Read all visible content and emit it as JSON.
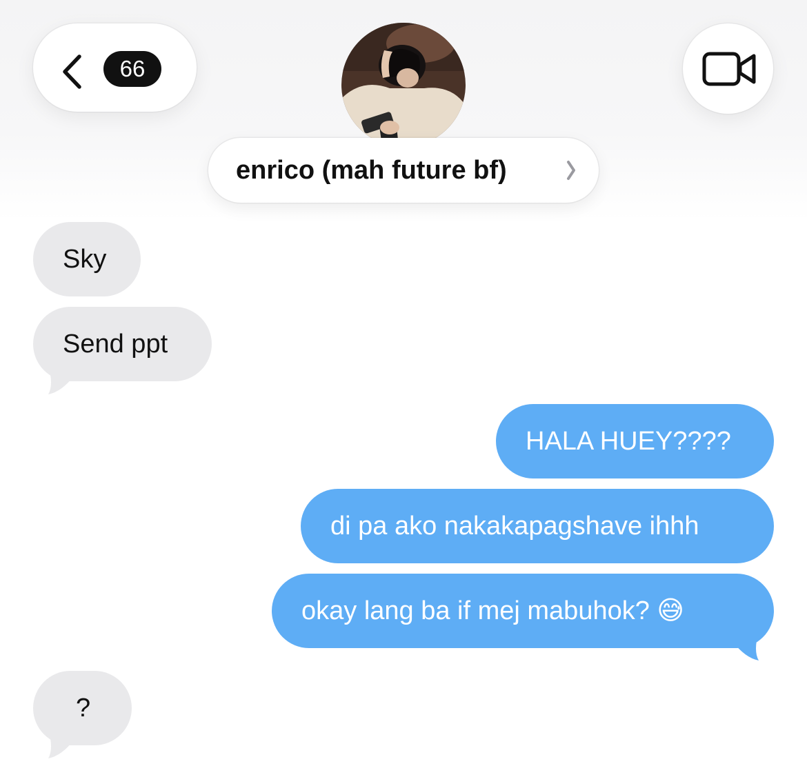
{
  "header": {
    "unread_count": "66",
    "contact_name": "enrico (mah future bf)",
    "icons": {
      "back": "chevron-left-icon",
      "video": "video-camera-icon",
      "name_chevron": "chevron-right-icon"
    }
  },
  "messages": [
    {
      "direction": "received",
      "text": "Sky"
    },
    {
      "direction": "received",
      "text": "Send ppt"
    },
    {
      "direction": "sent",
      "text": "HALA HUEY????"
    },
    {
      "direction": "sent",
      "text": "di pa ako nakakapagshave ihhh"
    },
    {
      "direction": "sent",
      "text": "okay lang ba if mej mabuhok? 😅"
    },
    {
      "direction": "received",
      "text": "?"
    }
  ],
  "colors": {
    "sent_bubble": "#5eadf5",
    "received_bubble": "#e9e9eb",
    "badge": "#111111"
  }
}
